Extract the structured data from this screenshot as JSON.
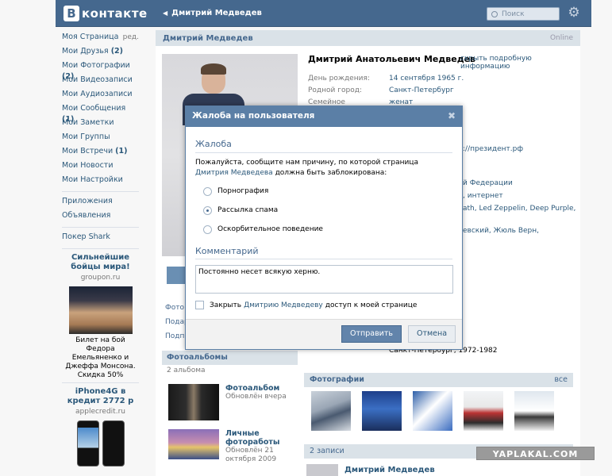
{
  "header": {
    "logo_letter": "В",
    "logo_text": "контакте",
    "page_title": "Дмитрий Медведев",
    "search_placeholder": "Поиск"
  },
  "sidebar": {
    "items": [
      {
        "label": "Моя Страница",
        "extra": "ред."
      },
      {
        "label": "Мои Друзья",
        "count": "(2)"
      },
      {
        "label": "Мои Фотографии",
        "count": "(2)"
      },
      {
        "label": "Мои Видеозаписи"
      },
      {
        "label": "Мои Аудиозаписи"
      },
      {
        "label": "Мои Сообщения",
        "count": "(1)"
      },
      {
        "label": "Мои Заметки"
      },
      {
        "label": "Мои Группы"
      },
      {
        "label": "Мои Встречи",
        "count": "(1)"
      },
      {
        "label": "Мои Новости"
      },
      {
        "label": "Мои Настройки"
      }
    ],
    "apps": [
      "Приложения",
      "Объявления"
    ],
    "game": "Покер Shark",
    "ad1": {
      "title": "Сильнейшие бойцы мира!",
      "domain": "groupon.ru",
      "text": "Билет на бой Федора Емельяненко и Джеффа Монсона. Скидка 50%"
    },
    "ad2": {
      "title": "iPhone4G в кредит 2772 р",
      "domain": "applecredit.ru"
    }
  },
  "profile": {
    "bar_name": "Дмитрий Медведев",
    "status": "Online",
    "full_name": "Дмитрий Анатольевич Медведев",
    "more_link": "скрыть подробную информацию",
    "fields": [
      {
        "key": "День рождения:",
        "value": "14 сентября 1965 г."
      },
      {
        "key": "Родной город:",
        "value": "Санкт-Петербург"
      },
      {
        "key": "Семейное положение:",
        "value": "женат"
      }
    ],
    "site_fragment": "://президент.рф",
    "interests_fragments": [
      "й Федерации",
      ", интернет",
      "ath, Led Zeppelin, Deep Purple,",
      "евский, Жюль Верн,"
    ],
    "education_fragment": "Санкт-Петербург, 1972-1982",
    "left_links": [
      "Фото",
      "Подар",
      "Подп"
    ],
    "albums_header": "Фотоальбомы",
    "albums_count": "2 альбома",
    "albums": [
      {
        "title": "Фотоальбом",
        "updated": "Обновлён вчера"
      },
      {
        "title": "Личные фотоработы",
        "updated": "Обновлён 21 октября 2009"
      }
    ],
    "photos_header": "Фотографии",
    "photos_all": "все",
    "wall_header": "2 записи",
    "wall_author": "Дмитрий Медведев"
  },
  "modal": {
    "title": "Жалоба на пользователя",
    "section_title": "Жалоба",
    "prompt_before": "Пожалуйста, сообщите нам причину, по которой страница ",
    "prompt_link": "Дмитрия Медведева",
    "prompt_after": " должна быть заблокирована:",
    "reasons": [
      {
        "label": "Порнография",
        "selected": false
      },
      {
        "label": "Рассылка спама",
        "selected": true
      },
      {
        "label": "Оскорбительное поведение",
        "selected": false
      }
    ],
    "comment_title": "Комментарий",
    "comment_value": "Постоянно несет всякую херню.",
    "checkbox_before": "Закрыть",
    "checkbox_link": "Дмитрию Медведеву",
    "checkbox_after": "доступ к моей странице",
    "send_label": "Отправить",
    "cancel_label": "Отмена"
  },
  "watermark": "YAPLAKAL.COM",
  "colors": {
    "brand": "#45688e",
    "link": "#2b587a",
    "modal_header": "#5b7fa6"
  }
}
